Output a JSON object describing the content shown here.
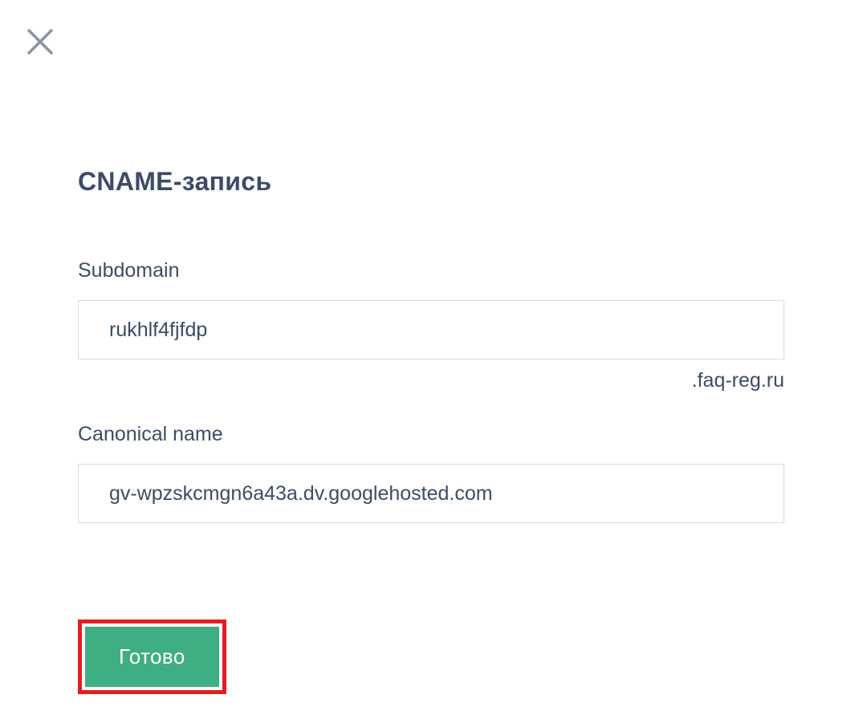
{
  "title": "CNAME-запись",
  "fields": {
    "subdomain": {
      "label": "Subdomain",
      "value": "rukhlf4fjfdp",
      "suffix": ".faq-reg.ru"
    },
    "canonical": {
      "label": "Canonical name",
      "value": "gv-wpzskcmgn6a43a.dv.googlehosted.com"
    }
  },
  "submit_label": "Готово"
}
